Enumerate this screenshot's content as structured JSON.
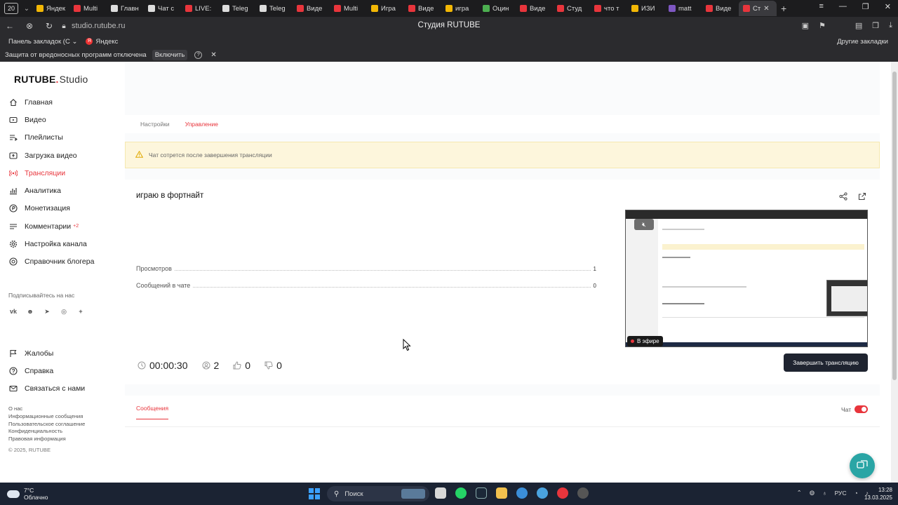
{
  "browser": {
    "tab_counter": "20",
    "tabs": [
      {
        "label": "Яндек",
        "color": "#f2b705"
      },
      {
        "label": "Multi",
        "color": "#e8353c"
      },
      {
        "label": "Главн",
        "color": "#dddddd"
      },
      {
        "label": "Чат с",
        "color": "#dddddd"
      },
      {
        "label": "LIVE:",
        "color": "#e8353c"
      },
      {
        "label": "Teleg",
        "color": "#dddddd"
      },
      {
        "label": "Teleg",
        "color": "#dddddd"
      },
      {
        "label": "Виде",
        "color": "#e8353c"
      },
      {
        "label": "Multi",
        "color": "#e8353c"
      },
      {
        "label": "Игра",
        "color": "#f2b705"
      },
      {
        "label": "Виде",
        "color": "#e8353c"
      },
      {
        "label": "игра",
        "color": "#f2b705"
      },
      {
        "label": "Оцин",
        "color": "#4caf50"
      },
      {
        "label": "Виде",
        "color": "#e8353c"
      },
      {
        "label": "Студ",
        "color": "#e8353c"
      },
      {
        "label": "что т",
        "color": "#e8353c"
      },
      {
        "label": "ИЗИ",
        "color": "#f2b705"
      },
      {
        "label": "matt",
        "color": "#7e57c2"
      },
      {
        "label": "Виде",
        "color": "#e8353c"
      }
    ],
    "active_tab": "Ст",
    "url": "studio.rutube.ru",
    "page_title": "Студия RUTUBE",
    "bookmarks_panel": "Панель закладок (С",
    "bookmark_yandex": "Яндекс",
    "other_bookmarks": "Другие закладки",
    "protection_message": "Защита от вредоносных программ отключена",
    "enable_label": "Включить"
  },
  "sidebar": {
    "logo_main": "RUTUBE",
    "logo_suffix": "Studio",
    "items": [
      {
        "label": "Главная"
      },
      {
        "label": "Видео"
      },
      {
        "label": "Плейлисты"
      },
      {
        "label": "Загрузка видео"
      },
      {
        "label": "Трансляции"
      },
      {
        "label": "Аналитика"
      },
      {
        "label": "Монетизация"
      },
      {
        "label": "Комментарии",
        "badge": "+2"
      },
      {
        "label": "Настройка канала"
      },
      {
        "label": "Справочник блогера"
      }
    ],
    "follow_label": "Подписывайтесь на нас",
    "secondary": [
      {
        "label": "Жалобы"
      },
      {
        "label": "Справка"
      },
      {
        "label": "Связаться с нами"
      }
    ],
    "footer_links": [
      "О нас",
      "Информационные сообщения",
      "Пользовательское соглашение",
      "Конфиденциальность",
      "Правовая информация"
    ],
    "copyright": "© 2025, RUTUBE"
  },
  "page_tabs": [
    "Настройки",
    "Управление"
  ],
  "notice": "Чат сотрется после завершения трансляции",
  "stream": {
    "title": "играю в фортнайт",
    "stats": [
      {
        "label": "Просмотров",
        "value": "1"
      },
      {
        "label": "Сообщений в чате",
        "value": "0"
      }
    ],
    "live_badge": "В эфире",
    "duration": "00:00:30",
    "viewers": "2",
    "likes": "0",
    "dislikes": "0",
    "end_button": "Завершить трансляцию"
  },
  "messages": {
    "tab": "Сообщения",
    "chat_label": "Чат",
    "chat_enabled": true
  },
  "taskbar": {
    "temp": "7°C",
    "weather": "Облачно",
    "search": "Поиск",
    "lang": "РУС",
    "time": "13:28",
    "date": "13.03.2025"
  },
  "colors": {
    "accent": "#e8353c",
    "button_dark": "#1f2430",
    "notice_bg": "#fdf6dc"
  }
}
